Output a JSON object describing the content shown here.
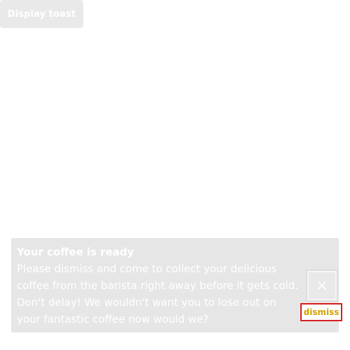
{
  "controls": {
    "display_toast_label": "Display toast"
  },
  "toast": {
    "title": "Your coffee is ready",
    "message": "Please dismiss and come to collect your delicious coffee from the barista right away before it gets cold. Don't delay! We wouldn't want you to lose out on your fantastic coffee now would we?",
    "dismiss_text": "dismiss"
  },
  "icons": {
    "close": "close-icon"
  },
  "colors": {
    "toast_bg": "#e6e6e6",
    "button_bg": "#e9e9e9",
    "dismiss_border": "#d81f1f",
    "dismiss_text": "#d4a000"
  }
}
